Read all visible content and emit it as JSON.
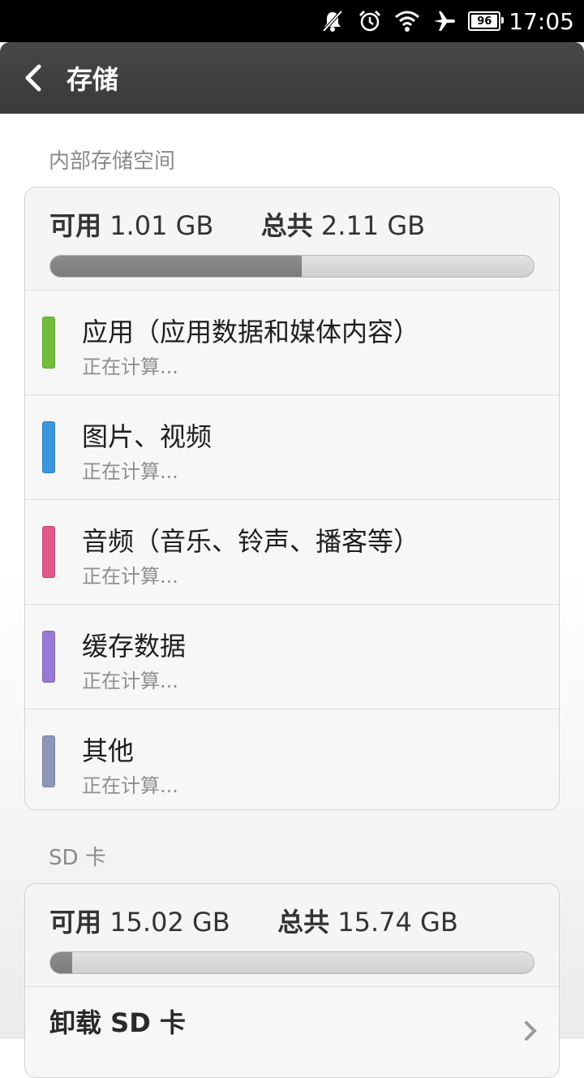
{
  "status_bar": {
    "battery": "96",
    "time": "17:05"
  },
  "header": {
    "title": "存储"
  },
  "internal": {
    "section_label": "内部存储空间",
    "available_label": "可用",
    "available_value": "1.01 GB",
    "total_label": "总共",
    "total_value": "2.11 GB",
    "used_fraction": 0.52,
    "categories": [
      {
        "title": "应用（应用数据和媒体内容）",
        "status": "正在计算...",
        "color": "#6fbf3a"
      },
      {
        "title": "图片、视频",
        "status": "正在计算...",
        "color": "#3b97dd"
      },
      {
        "title": "音频（音乐、铃声、播客等）",
        "status": "正在计算...",
        "color": "#e0578a"
      },
      {
        "title": "缓存数据",
        "status": "正在计算...",
        "color": "#9a78d8"
      },
      {
        "title": "其他",
        "status": "正在计算...",
        "color": "#8a97b8"
      }
    ]
  },
  "sd": {
    "section_label": "SD 卡",
    "available_label": "可用",
    "available_value": "15.02 GB",
    "total_label": "总共",
    "total_value": "15.74 GB",
    "used_fraction": 0.046,
    "unmount_label": "卸载 SD 卡"
  }
}
